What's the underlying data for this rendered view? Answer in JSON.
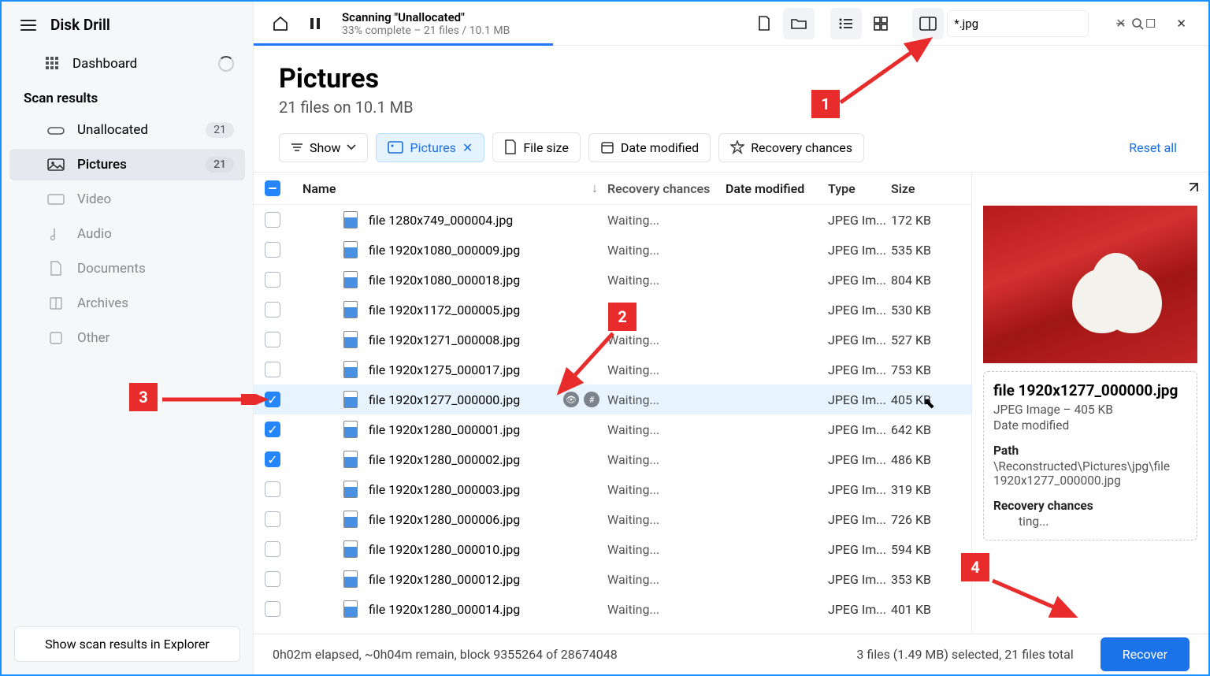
{
  "app_title": "Disk Drill",
  "sidebar": {
    "dashboard": "Dashboard",
    "section": "Scan results",
    "items": [
      {
        "label": "Unallocated",
        "badge": "21",
        "muted": false
      },
      {
        "label": "Pictures",
        "badge": "21",
        "active": true
      },
      {
        "label": "Video",
        "muted": true
      },
      {
        "label": "Audio",
        "muted": true
      },
      {
        "label": "Documents",
        "muted": true
      },
      {
        "label": "Archives",
        "muted": true
      },
      {
        "label": "Other",
        "muted": true
      }
    ],
    "footer_btn": "Show scan results in Explorer"
  },
  "topbar": {
    "scan_title": "Scanning \"Unallocated\"",
    "scan_sub": "33% complete – 21 files / 10.1 MB",
    "search_value": "*.jpg"
  },
  "heading": {
    "title": "Pictures",
    "sub": "21 files on 10.1 MB"
  },
  "filters": {
    "show": "Show",
    "pictures": "Pictures",
    "filesize": "File size",
    "date": "Date modified",
    "recovery": "Recovery chances",
    "reset": "Reset all"
  },
  "columns": {
    "name": "Name",
    "recovery": "Recovery chances",
    "date": "Date modified",
    "type": "Type",
    "size": "Size"
  },
  "rows": [
    {
      "name": "file 1280x749_000004.jpg",
      "rc": "Waiting...",
      "type": "JPEG Im...",
      "size": "172 KB",
      "checked": false
    },
    {
      "name": "file 1920x1080_000009.jpg",
      "rc": "Waiting...",
      "type": "JPEG Im...",
      "size": "535 KB",
      "checked": false
    },
    {
      "name": "file 1920x1080_000018.jpg",
      "rc": "Waiting...",
      "type": "JPEG Im...",
      "size": "804 KB",
      "checked": false
    },
    {
      "name": "file 1920x1172_000005.jpg",
      "rc": "ng...",
      "type": "JPEG Im...",
      "size": "530 KB",
      "checked": false
    },
    {
      "name": "file 1920x1271_000008.jpg",
      "rc": "Waiting...",
      "type": "JPEG Im...",
      "size": "527 KB",
      "checked": false
    },
    {
      "name": "file 1920x1275_000017.jpg",
      "rc": "Waiting...",
      "type": "JPEG Im...",
      "size": "753 KB",
      "checked": false
    },
    {
      "name": "file 1920x1277_000000.jpg",
      "rc": "Waiting...",
      "type": "JPEG Im...",
      "size": "405 KB",
      "checked": true,
      "sel": true,
      "icons": true
    },
    {
      "name": "file 1920x1280_000001.jpg",
      "rc": "Waiting...",
      "type": "JPEG Im...",
      "size": "642 KB",
      "checked": true
    },
    {
      "name": "file 1920x1280_000002.jpg",
      "rc": "Waiting...",
      "type": "JPEG Im...",
      "size": "486 KB",
      "checked": true
    },
    {
      "name": "file 1920x1280_000003.jpg",
      "rc": "Waiting...",
      "type": "JPEG Im...",
      "size": "319 KB",
      "checked": false
    },
    {
      "name": "file 1920x1280_000006.jpg",
      "rc": "Waiting...",
      "type": "JPEG Im...",
      "size": "726 KB",
      "checked": false
    },
    {
      "name": "file 1920x1280_000010.jpg",
      "rc": "Waiting...",
      "type": "JPEG Im...",
      "size": "594 KB",
      "checked": false
    },
    {
      "name": "file 1920x1280_000012.jpg",
      "rc": "Waiting...",
      "type": "JPEG Im...",
      "size": "353 KB",
      "checked": false
    },
    {
      "name": "file 1920x1280_000014.jpg",
      "rc": "Waiting...",
      "type": "JPEG Im...",
      "size": "401 KB",
      "checked": false
    }
  ],
  "preview": {
    "filename": "file 1920x1277_000000.jpg",
    "typeline": "JPEG Image – 405 KB",
    "date_label": "Date modified",
    "path_label": "Path",
    "path_value": "\\Reconstructed\\Pictures\\jpg\\file 1920x1277_000000.jpg",
    "rc_label": "Recovery chances",
    "rc_value": "ting..."
  },
  "status": {
    "left": "0h02m elapsed, ~0h04m remain, block 9355264 of 28674048",
    "right": "3 files (1.49 MB) selected, 21 files total",
    "recover": "Recover"
  },
  "annot": {
    "a1": "1",
    "a2": "2",
    "a3": "3",
    "a4": "4"
  }
}
